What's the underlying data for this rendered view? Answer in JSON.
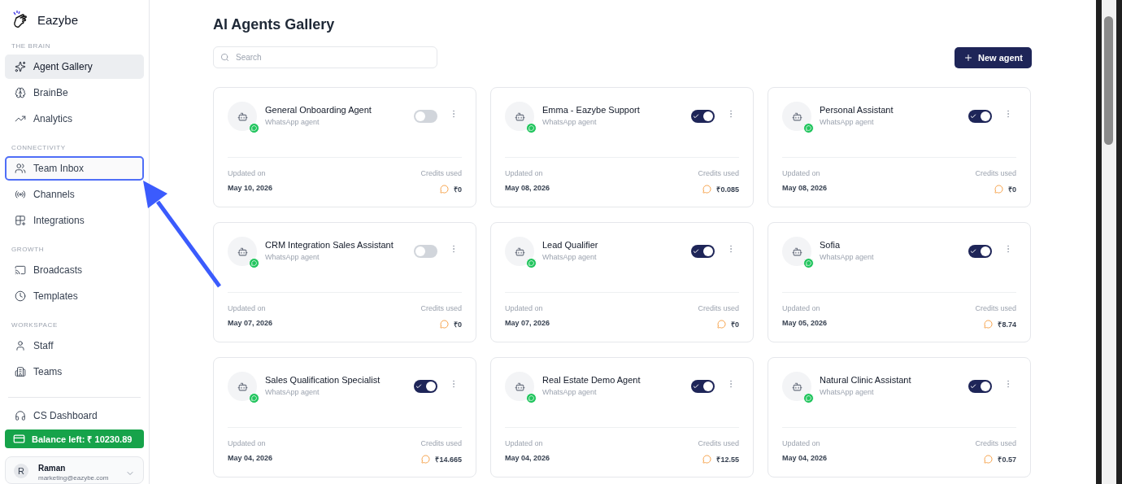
{
  "brand": {
    "name": "Eazybe"
  },
  "sidebar": {
    "sections": [
      {
        "title": "THE BRAIN",
        "items": [
          {
            "label": "Agent Gallery",
            "selected": true,
            "highlighted": false
          },
          {
            "label": "BrainBe",
            "selected": false,
            "highlighted": false
          },
          {
            "label": "Analytics",
            "selected": false,
            "highlighted": false
          }
        ]
      },
      {
        "title": "CONNECTIVITY",
        "items": [
          {
            "label": "Team Inbox",
            "selected": false,
            "highlighted": true
          },
          {
            "label": "Channels",
            "selected": false,
            "highlighted": false
          },
          {
            "label": "Integrations",
            "selected": false,
            "highlighted": false
          }
        ]
      },
      {
        "title": "GROWTH",
        "items": [
          {
            "label": "Broadcasts",
            "selected": false,
            "highlighted": false
          },
          {
            "label": "Templates",
            "selected": false,
            "highlighted": false
          }
        ]
      },
      {
        "title": "WORKSPACE",
        "items": [
          {
            "label": "Staff",
            "selected": false,
            "highlighted": false
          },
          {
            "label": "Teams",
            "selected": false,
            "highlighted": false
          }
        ]
      }
    ],
    "footer_item": {
      "label": "CS Dashboard"
    },
    "balance": "Balance left: ₹ 10230.89",
    "user": {
      "avatar": "R",
      "name": "Raman",
      "email": "marketing@eazybe.com"
    }
  },
  "page": {
    "title": "AI Agents Gallery",
    "search": {
      "placeholder": "Search"
    },
    "new_button": "New agent"
  },
  "agents": [
    {
      "name": "General Onboarding Agent",
      "type": "WhatsApp agent",
      "on": false,
      "updated_label": "Updated on",
      "updated": "May 10, 2026",
      "credits_label": "Credits used",
      "credits": "₹0"
    },
    {
      "name": "Emma - Eazybe Support",
      "type": "WhatsApp agent",
      "on": true,
      "updated_label": "Updated on",
      "updated": "May 08, 2026",
      "credits_label": "Credits used",
      "credits": "₹0.085"
    },
    {
      "name": "Personal Assistant",
      "type": "WhatsApp agent",
      "on": true,
      "updated_label": "Updated on",
      "updated": "May 08, 2026",
      "credits_label": "Credits used",
      "credits": "₹0"
    },
    {
      "name": "CRM Integration Sales Assistant",
      "type": "WhatsApp agent",
      "on": false,
      "updated_label": "Updated on",
      "updated": "May 07, 2026",
      "credits_label": "Credits used",
      "credits": "₹0"
    },
    {
      "name": "Lead Qualifier",
      "type": "WhatsApp agent",
      "on": true,
      "updated_label": "Updated on",
      "updated": "May 07, 2026",
      "credits_label": "Credits used",
      "credits": "₹0"
    },
    {
      "name": "Sofia",
      "type": "WhatsApp agent",
      "on": true,
      "updated_label": "Updated on",
      "updated": "May 05, 2026",
      "credits_label": "Credits used",
      "credits": "₹8.74"
    },
    {
      "name": "Sales Qualification Specialist",
      "type": "WhatsApp agent",
      "on": true,
      "updated_label": "Updated on",
      "updated": "May 04, 2026",
      "credits_label": "Credits used",
      "credits": "₹14.665"
    },
    {
      "name": "Real Estate Demo Agent",
      "type": "WhatsApp agent",
      "on": true,
      "updated_label": "Updated on",
      "updated": "May 04, 2026",
      "credits_label": "Credits used",
      "credits": "₹12.55"
    },
    {
      "name": "Natural Clinic Assistant",
      "type": "WhatsApp agent",
      "on": true,
      "updated_label": "Updated on",
      "updated": "May 04, 2026",
      "credits_label": "Credits used",
      "credits": "₹0.57"
    }
  ]
}
